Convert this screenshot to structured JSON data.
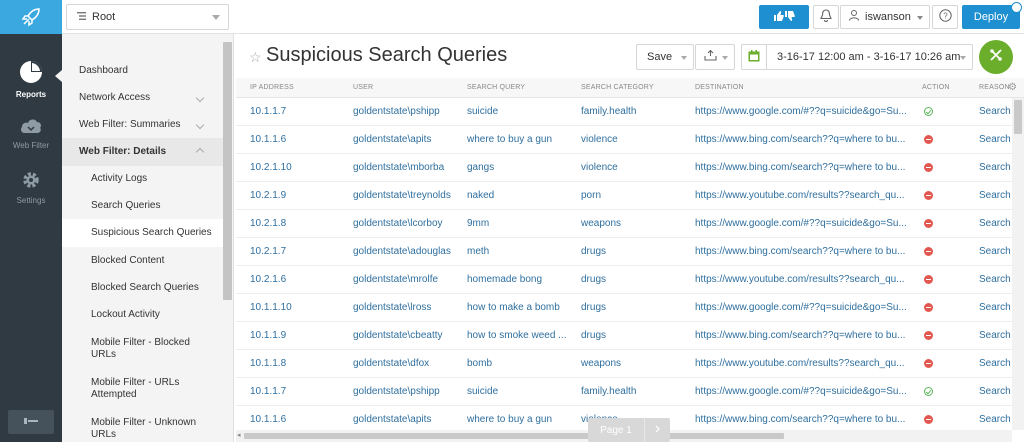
{
  "rail": {
    "items": [
      {
        "label": "Reports",
        "icon": "pie-chart-icon"
      },
      {
        "label": "Web Filter",
        "icon": "cloud-icon"
      },
      {
        "label": "Settings",
        "icon": "gear-icon"
      }
    ]
  },
  "topbar": {
    "root_label": "Root",
    "user_label": "iswanson",
    "deploy_label": "Deploy"
  },
  "nav": {
    "items": [
      {
        "label": "Dashboard"
      },
      {
        "label": "Network Access"
      },
      {
        "label": "Web Filter: Summaries"
      },
      {
        "label": "Web Filter: Details"
      },
      {
        "label": "Activity Logs"
      },
      {
        "label": "Search Queries"
      },
      {
        "label": "Suspicious Search Queries"
      },
      {
        "label": "Blocked Content"
      },
      {
        "label": "Blocked Search Queries"
      },
      {
        "label": "Lockout Activity"
      },
      {
        "label": "Mobile Filter - Blocked URLs"
      },
      {
        "label": "Mobile Filter - URLs Attempted"
      },
      {
        "label": "Mobile Filter - Unknown URLs"
      }
    ]
  },
  "page": {
    "title": "Suspicious Search Queries",
    "save_label": "Save",
    "date_range": "3-16-17 12:00 am - 3-16-17 10:26 am"
  },
  "table": {
    "columns": [
      "IP ADDRESS",
      "USER",
      "SEARCH QUERY",
      "SEARCH CATEGORY",
      "DESTINATION",
      "ACTION",
      "REASON"
    ],
    "rows": [
      {
        "ip": "10.1.1.7",
        "user": "goldentstate\\pshipp",
        "query": "suicide",
        "category": "family.health",
        "destination": "https://www.google.com/#??q=suicide&go=Su...",
        "action": "allowed",
        "reason": "Search"
      },
      {
        "ip": "10.1.1.6",
        "user": "goldentstate\\apits",
        "query": "where to buy a gun",
        "category": "violence",
        "destination": "https://www.bing.com/search??q=where to bu...",
        "action": "blocked",
        "reason": "Search"
      },
      {
        "ip": "10.2.1.10",
        "user": "goldentstate\\mborba",
        "query": "gangs",
        "category": "violence",
        "destination": "https://www.bing.com/search??q=where to bu...",
        "action": "blocked",
        "reason": "Search"
      },
      {
        "ip": "10.2.1.9",
        "user": "goldentstate\\treynolds",
        "query": "naked",
        "category": "porn",
        "destination": "https://www.youtube.com/results??search_qu...",
        "action": "blocked",
        "reason": "Search"
      },
      {
        "ip": "10.2.1.8",
        "user": "goldentstate\\lcorboy",
        "query": "9mm",
        "category": "weapons",
        "destination": "https://www.google.com/#??q=suicide&go=Su...",
        "action": "blocked",
        "reason": "Search"
      },
      {
        "ip": "10.2.1.7",
        "user": "goldentstate\\adouglas",
        "query": "meth",
        "category": "drugs",
        "destination": "https://www.bing.com/search??q=where to bu...",
        "action": "blocked",
        "reason": "Search"
      },
      {
        "ip": "10.2.1.6",
        "user": "goldentstate\\mrolfe",
        "query": "homemade bong",
        "category": "drugs",
        "destination": "https://www.youtube.com/results??search_qu...",
        "action": "blocked",
        "reason": "Search"
      },
      {
        "ip": "10.1.1.10",
        "user": "goldentstate\\lross",
        "query": "how to make a bomb",
        "category": "drugs",
        "destination": "https://www.google.com/#??q=suicide&go=Su...",
        "action": "blocked",
        "reason": "Search"
      },
      {
        "ip": "10.1.1.9",
        "user": "goldentstate\\cbeatty",
        "query": "how to smoke weed ...",
        "category": "drugs",
        "destination": "https://www.bing.com/search??q=where to bu...",
        "action": "blocked",
        "reason": "Search"
      },
      {
        "ip": "10.1.1.8",
        "user": "goldentstate\\dfox",
        "query": "bomb",
        "category": "weapons",
        "destination": "https://www.youtube.com/results??search_qu...",
        "action": "blocked",
        "reason": "Search"
      },
      {
        "ip": "10.1.1.7",
        "user": "goldentstate\\pshipp",
        "query": "suicide",
        "category": "family.health",
        "destination": "https://www.google.com/#??q=suicide&go=Su...",
        "action": "allowed",
        "reason": "Search"
      },
      {
        "ip": "10.1.1.6",
        "user": "goldentstate\\apits",
        "query": "where to buy a gun",
        "category": "violence",
        "destination": "https://www.bing.com/search??q=where to bu...",
        "action": "blocked",
        "reason": "Search"
      }
    ]
  },
  "pager": {
    "label": "Page 1"
  },
  "colors": {
    "accent": "#1e8fd0",
    "rail": "#2f3a43",
    "fab": "#6aae2b",
    "link": "#2f6f9f",
    "allowed": "#5cb85c",
    "blocked": "#e0584f"
  }
}
